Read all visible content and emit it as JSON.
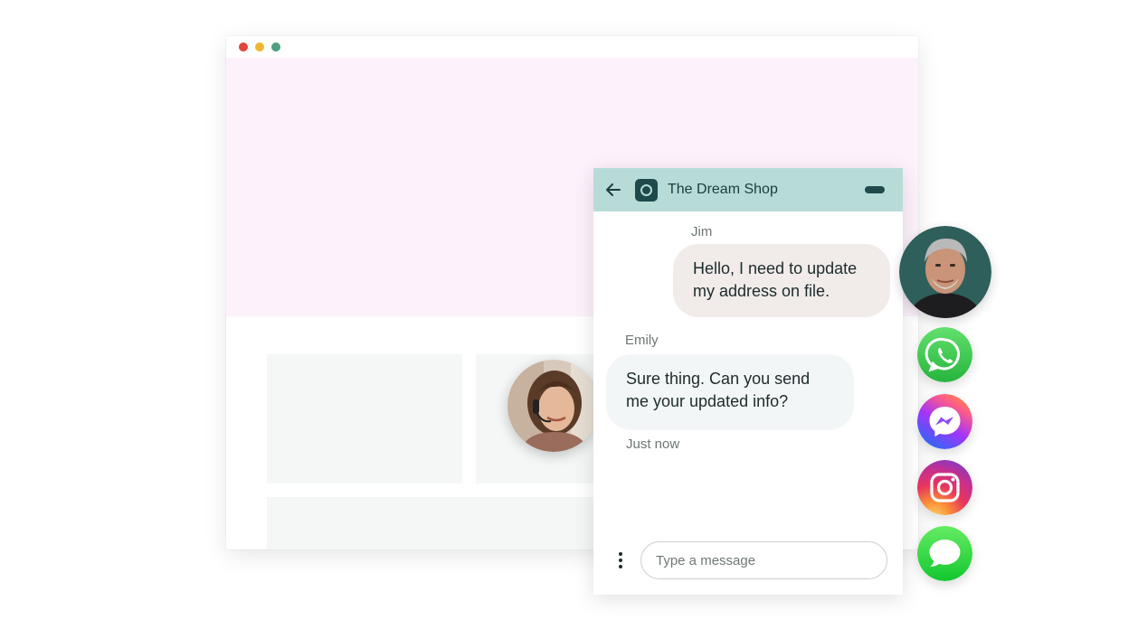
{
  "chat": {
    "shop_name": "The Dream Shop",
    "messages": [
      {
        "sender": "Jim",
        "text": "Hello, I need to update my address on file."
      },
      {
        "sender": "Emily",
        "text": "Sure thing. Can you send me your updated info?"
      }
    ],
    "timestamp": "Just now",
    "input_placeholder": "Type a message"
  },
  "colors": {
    "header_bg": "#b7dcd8",
    "brand_dark": "#1f4a4b",
    "hero_bg": "#fdf1fb",
    "customer_bubble": "#f1ecea",
    "agent_bubble": "#f3f6f6"
  },
  "channels": [
    {
      "name": "whatsapp-icon"
    },
    {
      "name": "messenger-icon"
    },
    {
      "name": "instagram-icon"
    },
    {
      "name": "imessage-icon"
    }
  ]
}
